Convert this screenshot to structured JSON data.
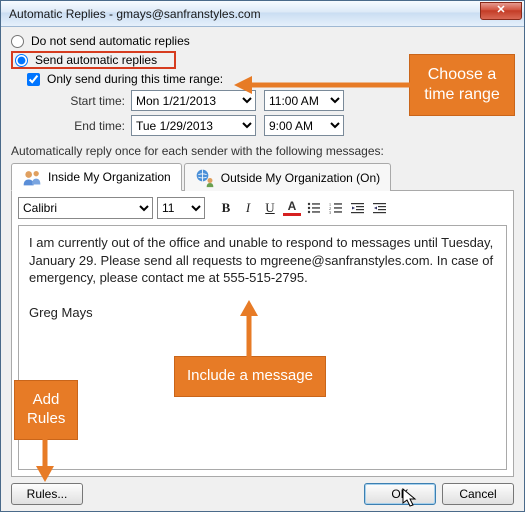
{
  "window": {
    "title": "Automatic Replies - gmays@sanfranstyles.com",
    "close_glyph": "✕"
  },
  "radios": {
    "dont_send": "Do not send automatic replies",
    "send": "Send automatic replies"
  },
  "timerange": {
    "checkbox_label": "Only send during this time range:",
    "start_label": "Start time:",
    "end_label": "End time:",
    "start_date": "Mon 1/21/2013",
    "start_time": "11:00 AM",
    "end_date": "Tue 1/29/2013",
    "end_time": "9:00 AM"
  },
  "reply_label": "Automatically reply once for each sender with the following messages:",
  "tabs": {
    "inside": "Inside My Organization",
    "outside": "Outside My Organization (On)"
  },
  "toolbar": {
    "font": "Calibri",
    "size": "11",
    "bold": "B",
    "italic": "I",
    "underline": "U",
    "fontcolor": "A"
  },
  "message": {
    "body1": "I am currently out of the office and unable to respond to messages until Tuesday, January 29. Please send all requests to mgreene@sanfranstyles.com. In case of emergency, please contact me at 555-515-2795.",
    "signoff": "Greg Mays"
  },
  "buttons": {
    "rules": "Rules...",
    "ok": "OK",
    "cancel": "Cancel"
  },
  "callouts": {
    "time": "Choose a\ntime range",
    "rules": "Add\nRules",
    "msg": "Include a message"
  }
}
